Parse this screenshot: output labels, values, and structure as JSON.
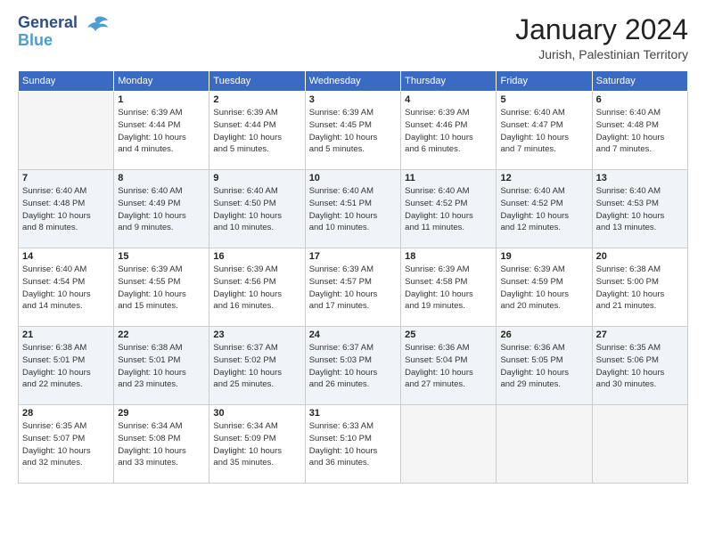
{
  "logo": {
    "line1": "General",
    "line2": "Blue"
  },
  "title": "January 2024",
  "location": "Jurish, Palestinian Territory",
  "weekdays": [
    "Sunday",
    "Monday",
    "Tuesday",
    "Wednesday",
    "Thursday",
    "Friday",
    "Saturday"
  ],
  "weeks": [
    [
      {
        "day": "",
        "info": ""
      },
      {
        "day": "1",
        "info": "Sunrise: 6:39 AM\nSunset: 4:44 PM\nDaylight: 10 hours\nand 4 minutes."
      },
      {
        "day": "2",
        "info": "Sunrise: 6:39 AM\nSunset: 4:44 PM\nDaylight: 10 hours\nand 5 minutes."
      },
      {
        "day": "3",
        "info": "Sunrise: 6:39 AM\nSunset: 4:45 PM\nDaylight: 10 hours\nand 5 minutes."
      },
      {
        "day": "4",
        "info": "Sunrise: 6:39 AM\nSunset: 4:46 PM\nDaylight: 10 hours\nand 6 minutes."
      },
      {
        "day": "5",
        "info": "Sunrise: 6:40 AM\nSunset: 4:47 PM\nDaylight: 10 hours\nand 7 minutes."
      },
      {
        "day": "6",
        "info": "Sunrise: 6:40 AM\nSunset: 4:48 PM\nDaylight: 10 hours\nand 7 minutes."
      }
    ],
    [
      {
        "day": "7",
        "info": "Sunrise: 6:40 AM\nSunset: 4:48 PM\nDaylight: 10 hours\nand 8 minutes."
      },
      {
        "day": "8",
        "info": "Sunrise: 6:40 AM\nSunset: 4:49 PM\nDaylight: 10 hours\nand 9 minutes."
      },
      {
        "day": "9",
        "info": "Sunrise: 6:40 AM\nSunset: 4:50 PM\nDaylight: 10 hours\nand 10 minutes."
      },
      {
        "day": "10",
        "info": "Sunrise: 6:40 AM\nSunset: 4:51 PM\nDaylight: 10 hours\nand 10 minutes."
      },
      {
        "day": "11",
        "info": "Sunrise: 6:40 AM\nSunset: 4:52 PM\nDaylight: 10 hours\nand 11 minutes."
      },
      {
        "day": "12",
        "info": "Sunrise: 6:40 AM\nSunset: 4:52 PM\nDaylight: 10 hours\nand 12 minutes."
      },
      {
        "day": "13",
        "info": "Sunrise: 6:40 AM\nSunset: 4:53 PM\nDaylight: 10 hours\nand 13 minutes."
      }
    ],
    [
      {
        "day": "14",
        "info": "Sunrise: 6:40 AM\nSunset: 4:54 PM\nDaylight: 10 hours\nand 14 minutes."
      },
      {
        "day": "15",
        "info": "Sunrise: 6:39 AM\nSunset: 4:55 PM\nDaylight: 10 hours\nand 15 minutes."
      },
      {
        "day": "16",
        "info": "Sunrise: 6:39 AM\nSunset: 4:56 PM\nDaylight: 10 hours\nand 16 minutes."
      },
      {
        "day": "17",
        "info": "Sunrise: 6:39 AM\nSunset: 4:57 PM\nDaylight: 10 hours\nand 17 minutes."
      },
      {
        "day": "18",
        "info": "Sunrise: 6:39 AM\nSunset: 4:58 PM\nDaylight: 10 hours\nand 19 minutes."
      },
      {
        "day": "19",
        "info": "Sunrise: 6:39 AM\nSunset: 4:59 PM\nDaylight: 10 hours\nand 20 minutes."
      },
      {
        "day": "20",
        "info": "Sunrise: 6:38 AM\nSunset: 5:00 PM\nDaylight: 10 hours\nand 21 minutes."
      }
    ],
    [
      {
        "day": "21",
        "info": "Sunrise: 6:38 AM\nSunset: 5:01 PM\nDaylight: 10 hours\nand 22 minutes."
      },
      {
        "day": "22",
        "info": "Sunrise: 6:38 AM\nSunset: 5:01 PM\nDaylight: 10 hours\nand 23 minutes."
      },
      {
        "day": "23",
        "info": "Sunrise: 6:37 AM\nSunset: 5:02 PM\nDaylight: 10 hours\nand 25 minutes."
      },
      {
        "day": "24",
        "info": "Sunrise: 6:37 AM\nSunset: 5:03 PM\nDaylight: 10 hours\nand 26 minutes."
      },
      {
        "day": "25",
        "info": "Sunrise: 6:36 AM\nSunset: 5:04 PM\nDaylight: 10 hours\nand 27 minutes."
      },
      {
        "day": "26",
        "info": "Sunrise: 6:36 AM\nSunset: 5:05 PM\nDaylight: 10 hours\nand 29 minutes."
      },
      {
        "day": "27",
        "info": "Sunrise: 6:35 AM\nSunset: 5:06 PM\nDaylight: 10 hours\nand 30 minutes."
      }
    ],
    [
      {
        "day": "28",
        "info": "Sunrise: 6:35 AM\nSunset: 5:07 PM\nDaylight: 10 hours\nand 32 minutes."
      },
      {
        "day": "29",
        "info": "Sunrise: 6:34 AM\nSunset: 5:08 PM\nDaylight: 10 hours\nand 33 minutes."
      },
      {
        "day": "30",
        "info": "Sunrise: 6:34 AM\nSunset: 5:09 PM\nDaylight: 10 hours\nand 35 minutes."
      },
      {
        "day": "31",
        "info": "Sunrise: 6:33 AM\nSunset: 5:10 PM\nDaylight: 10 hours\nand 36 minutes."
      },
      {
        "day": "",
        "info": ""
      },
      {
        "day": "",
        "info": ""
      },
      {
        "day": "",
        "info": ""
      }
    ]
  ]
}
